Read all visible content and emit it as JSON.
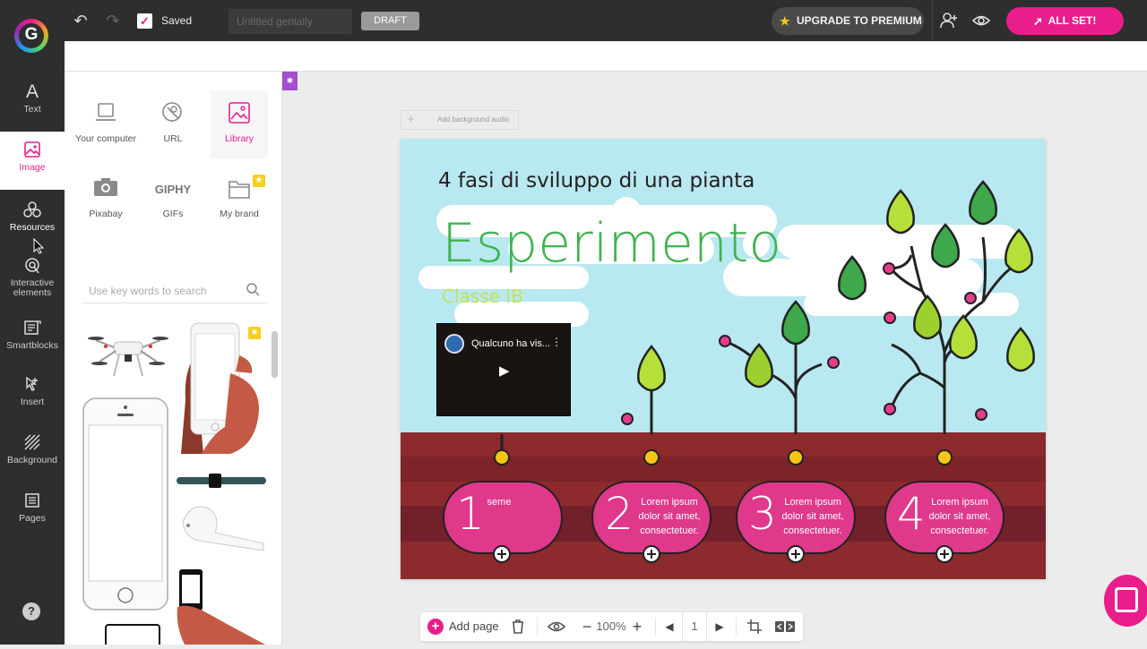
{
  "topbar": {
    "saved_label": "Saved",
    "title_placeholder": "Untitled genially",
    "draft_label": "DRAFT",
    "premium_label": "UPGRADE TO PREMIUM",
    "allset_label": "ALL SET!",
    "accent_color": "#e91e8c"
  },
  "sidebar": {
    "items": [
      {
        "label": "Text",
        "icon": "text-icon"
      },
      {
        "label": "Image",
        "icon": "image-icon"
      },
      {
        "label": "Resources",
        "icon": "resources-icon"
      },
      {
        "label": "Interactive elements",
        "icon": "interactive-icon"
      },
      {
        "label": "Smartblocks",
        "icon": "smartblocks-icon"
      },
      {
        "label": "Insert",
        "icon": "insert-icon"
      },
      {
        "label": "Background",
        "icon": "background-icon"
      },
      {
        "label": "Pages",
        "icon": "pages-icon"
      }
    ],
    "active": "Image",
    "help_label": "?"
  },
  "image_panel": {
    "sources": [
      {
        "label": "Your computer",
        "icon": "laptop-icon"
      },
      {
        "label": "URL",
        "icon": "link-icon"
      },
      {
        "label": "Library",
        "icon": "library-icon"
      },
      {
        "label": "Pixabay",
        "icon": "camera-icon"
      },
      {
        "label": "GIFs",
        "logo": "GIPHY"
      },
      {
        "label": "My brand",
        "icon": "folder-icon"
      }
    ],
    "search_placeholder": "Use key words to search"
  },
  "slide": {
    "audio_label": "Add background audio",
    "subtitle": "4 fasi di sviluppo di una pianta",
    "title": "Esperimento",
    "class_label": "Classe IB",
    "video_title": "Qualcuno ha vis...",
    "stages": [
      {
        "number": "1",
        "text": "seme"
      },
      {
        "number": "2",
        "text": "Lorem ipsum dolor sit amet, consectetuer."
      },
      {
        "number": "3",
        "text": "Lorem ipsum dolor sit amet, consectetuer."
      },
      {
        "number": "4",
        "text": "Lorem ipsum dolor sit amet, consectetuer."
      }
    ]
  },
  "bottombar": {
    "add_page_label": "Add page",
    "zoom": "100%",
    "page_number": "1"
  }
}
